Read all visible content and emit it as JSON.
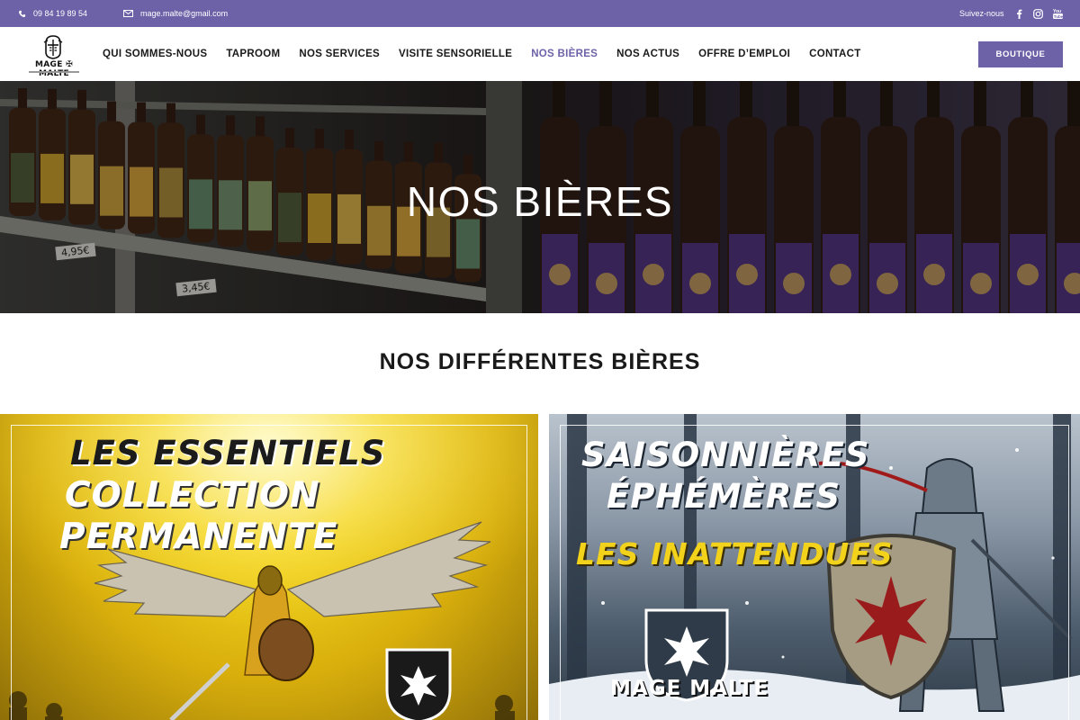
{
  "topbar": {
    "phone": "09 84 19 89 54",
    "email": "mage.malte@gmail.com",
    "follow_label": "Suivez-nous",
    "social_icons": [
      "facebook-icon",
      "instagram-icon",
      "youtube-icon"
    ],
    "background": "#6d62a8"
  },
  "header": {
    "logo_text": "MAGE ✠ MALTE",
    "nav": [
      {
        "label": "QUI SOMMES-NOUS",
        "active": false
      },
      {
        "label": "TAPROOM",
        "active": false
      },
      {
        "label": "NOS SERVICES",
        "active": false
      },
      {
        "label": "VISITE SENSORIELLE",
        "active": false
      },
      {
        "label": "NOS BIÈRES",
        "active": true
      },
      {
        "label": "NOS ACTUS",
        "active": false
      },
      {
        "label": "OFFRE D’EMPLOI",
        "active": false
      },
      {
        "label": "CONTACT",
        "active": false
      }
    ],
    "cta_label": "BOUTIQUE",
    "accent_color": "#6d62a8"
  },
  "hero": {
    "title": "NOS BIÈRES",
    "prices": [
      "4,95€",
      "3,45€"
    ]
  },
  "section": {
    "title": "NOS DIFFÉRENTES BIÈRES"
  },
  "cards": [
    {
      "lines": [
        "LES ESSENTIELS",
        "COLLECTION",
        "PERMANENTE"
      ],
      "accent": "#f4d51f"
    },
    {
      "lines": [
        "SAISONNIÈRES",
        "ÉPHÉMÈRES",
        "LES INATTENDUES"
      ],
      "brand": "MAGE MALTE",
      "accent": "#f2d21a"
    }
  ]
}
